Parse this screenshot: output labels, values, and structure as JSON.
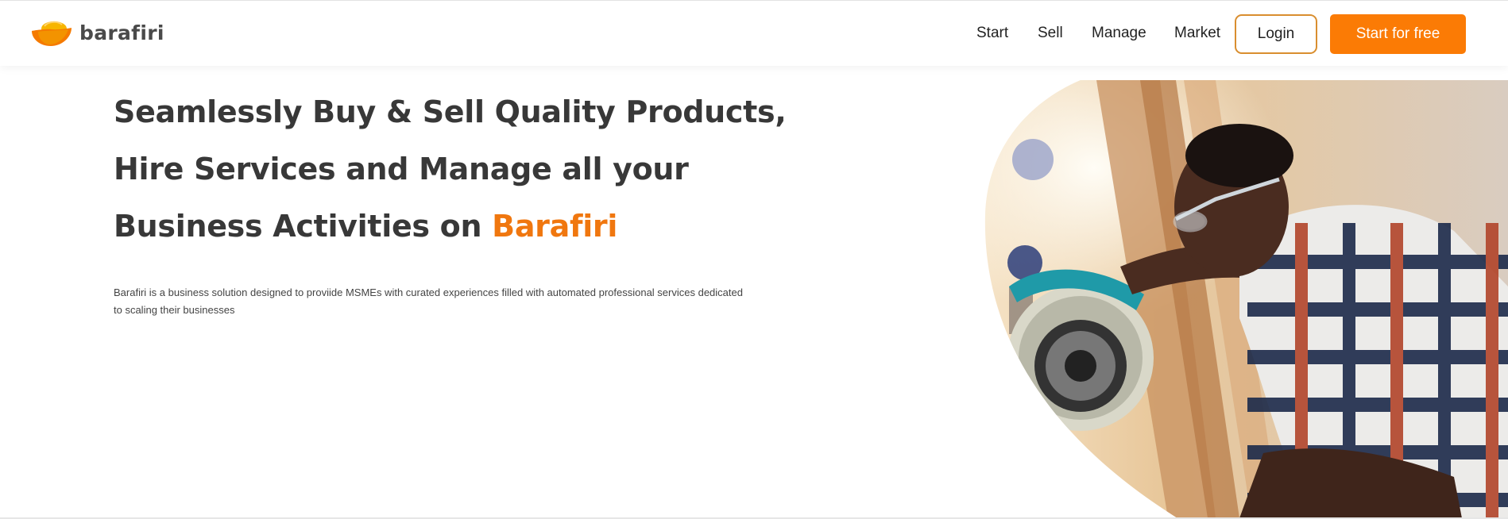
{
  "header": {
    "logo_text": "barafiri",
    "nav": [
      {
        "label": "Start"
      },
      {
        "label": "Sell"
      },
      {
        "label": "Manage"
      },
      {
        "label": "Market"
      }
    ],
    "login_label": "Login",
    "cta_label": "Start for free"
  },
  "hero": {
    "title_line1": "Seamlessly Buy & Sell Quality Products,",
    "title_line2": "Hire Services and Manage all your",
    "title_line3_prefix": "Business Activities on ",
    "title_brand": "Barafiri",
    "description": "Barafiri is a business solution designed to proviide MSMEs with curated experiences filled with automated professional services dedicated to scaling their businesses"
  },
  "colors": {
    "accent": "#fb7b05",
    "brand_text": "#f0770f",
    "login_border": "#d98e2f",
    "heading": "#383838"
  },
  "icons": {
    "logo": "barafiri-logo-bowl-icon"
  }
}
